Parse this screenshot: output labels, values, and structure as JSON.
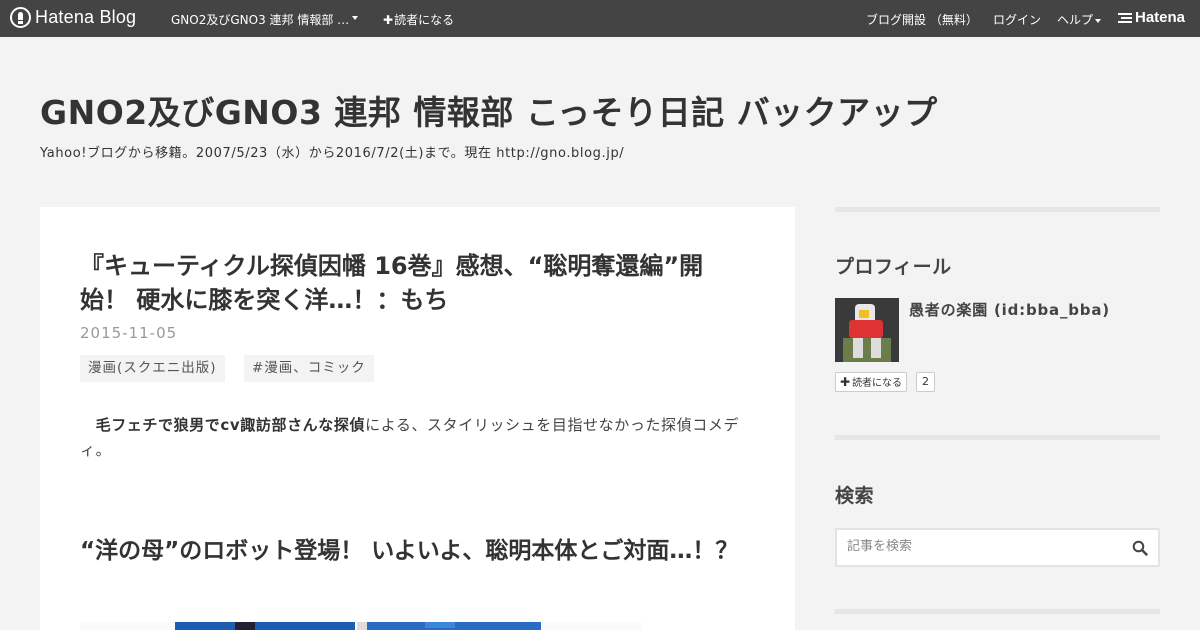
{
  "globalheader": {
    "logo_text": "Hatena Blog",
    "blog_title": "GNO2及びGNO3 連邦 情報部 …",
    "subscribe_label": "読者になる",
    "open_blog_label": "ブログ開設 （無料）",
    "login_label": "ログイン",
    "help_label": "ヘルプ",
    "hatena_label": "Hatena"
  },
  "blog": {
    "title": "GNO2及びGNO3 連邦 情報部 こっそり日記 バックアップ",
    "description": "Yahoo!ブログから移籍。2007/5/23（水）から2016/7/2(土)まで。現在 http://gno.blog.jp/"
  },
  "entry": {
    "title": "『キューティクル探偵因幡 16巻』感想、“聡明奪還編”開始！ 硬水に膝を突く洋…！：もち",
    "date": "2015-11-05",
    "categories": [
      "漫画(スクエニ出版)",
      "#漫画、コミック"
    ],
    "body_strong": "毛フェチで狼男でcv諏訪部さんな探偵",
    "body_rest": "による、スタイリッシュを目指せなかった探偵コメディ。",
    "heading": "“洋の母”のロボット登場！ いよいよ、聡明本体とご対面…！？"
  },
  "sidebar": {
    "profile_heading": "プロフィール",
    "profile_name": "愚者の楽園 (id:bba_bba)",
    "subscribe_label": "読者になる",
    "subscriber_count": "2",
    "search_heading": "検索",
    "search_placeholder": "記事を検索"
  }
}
